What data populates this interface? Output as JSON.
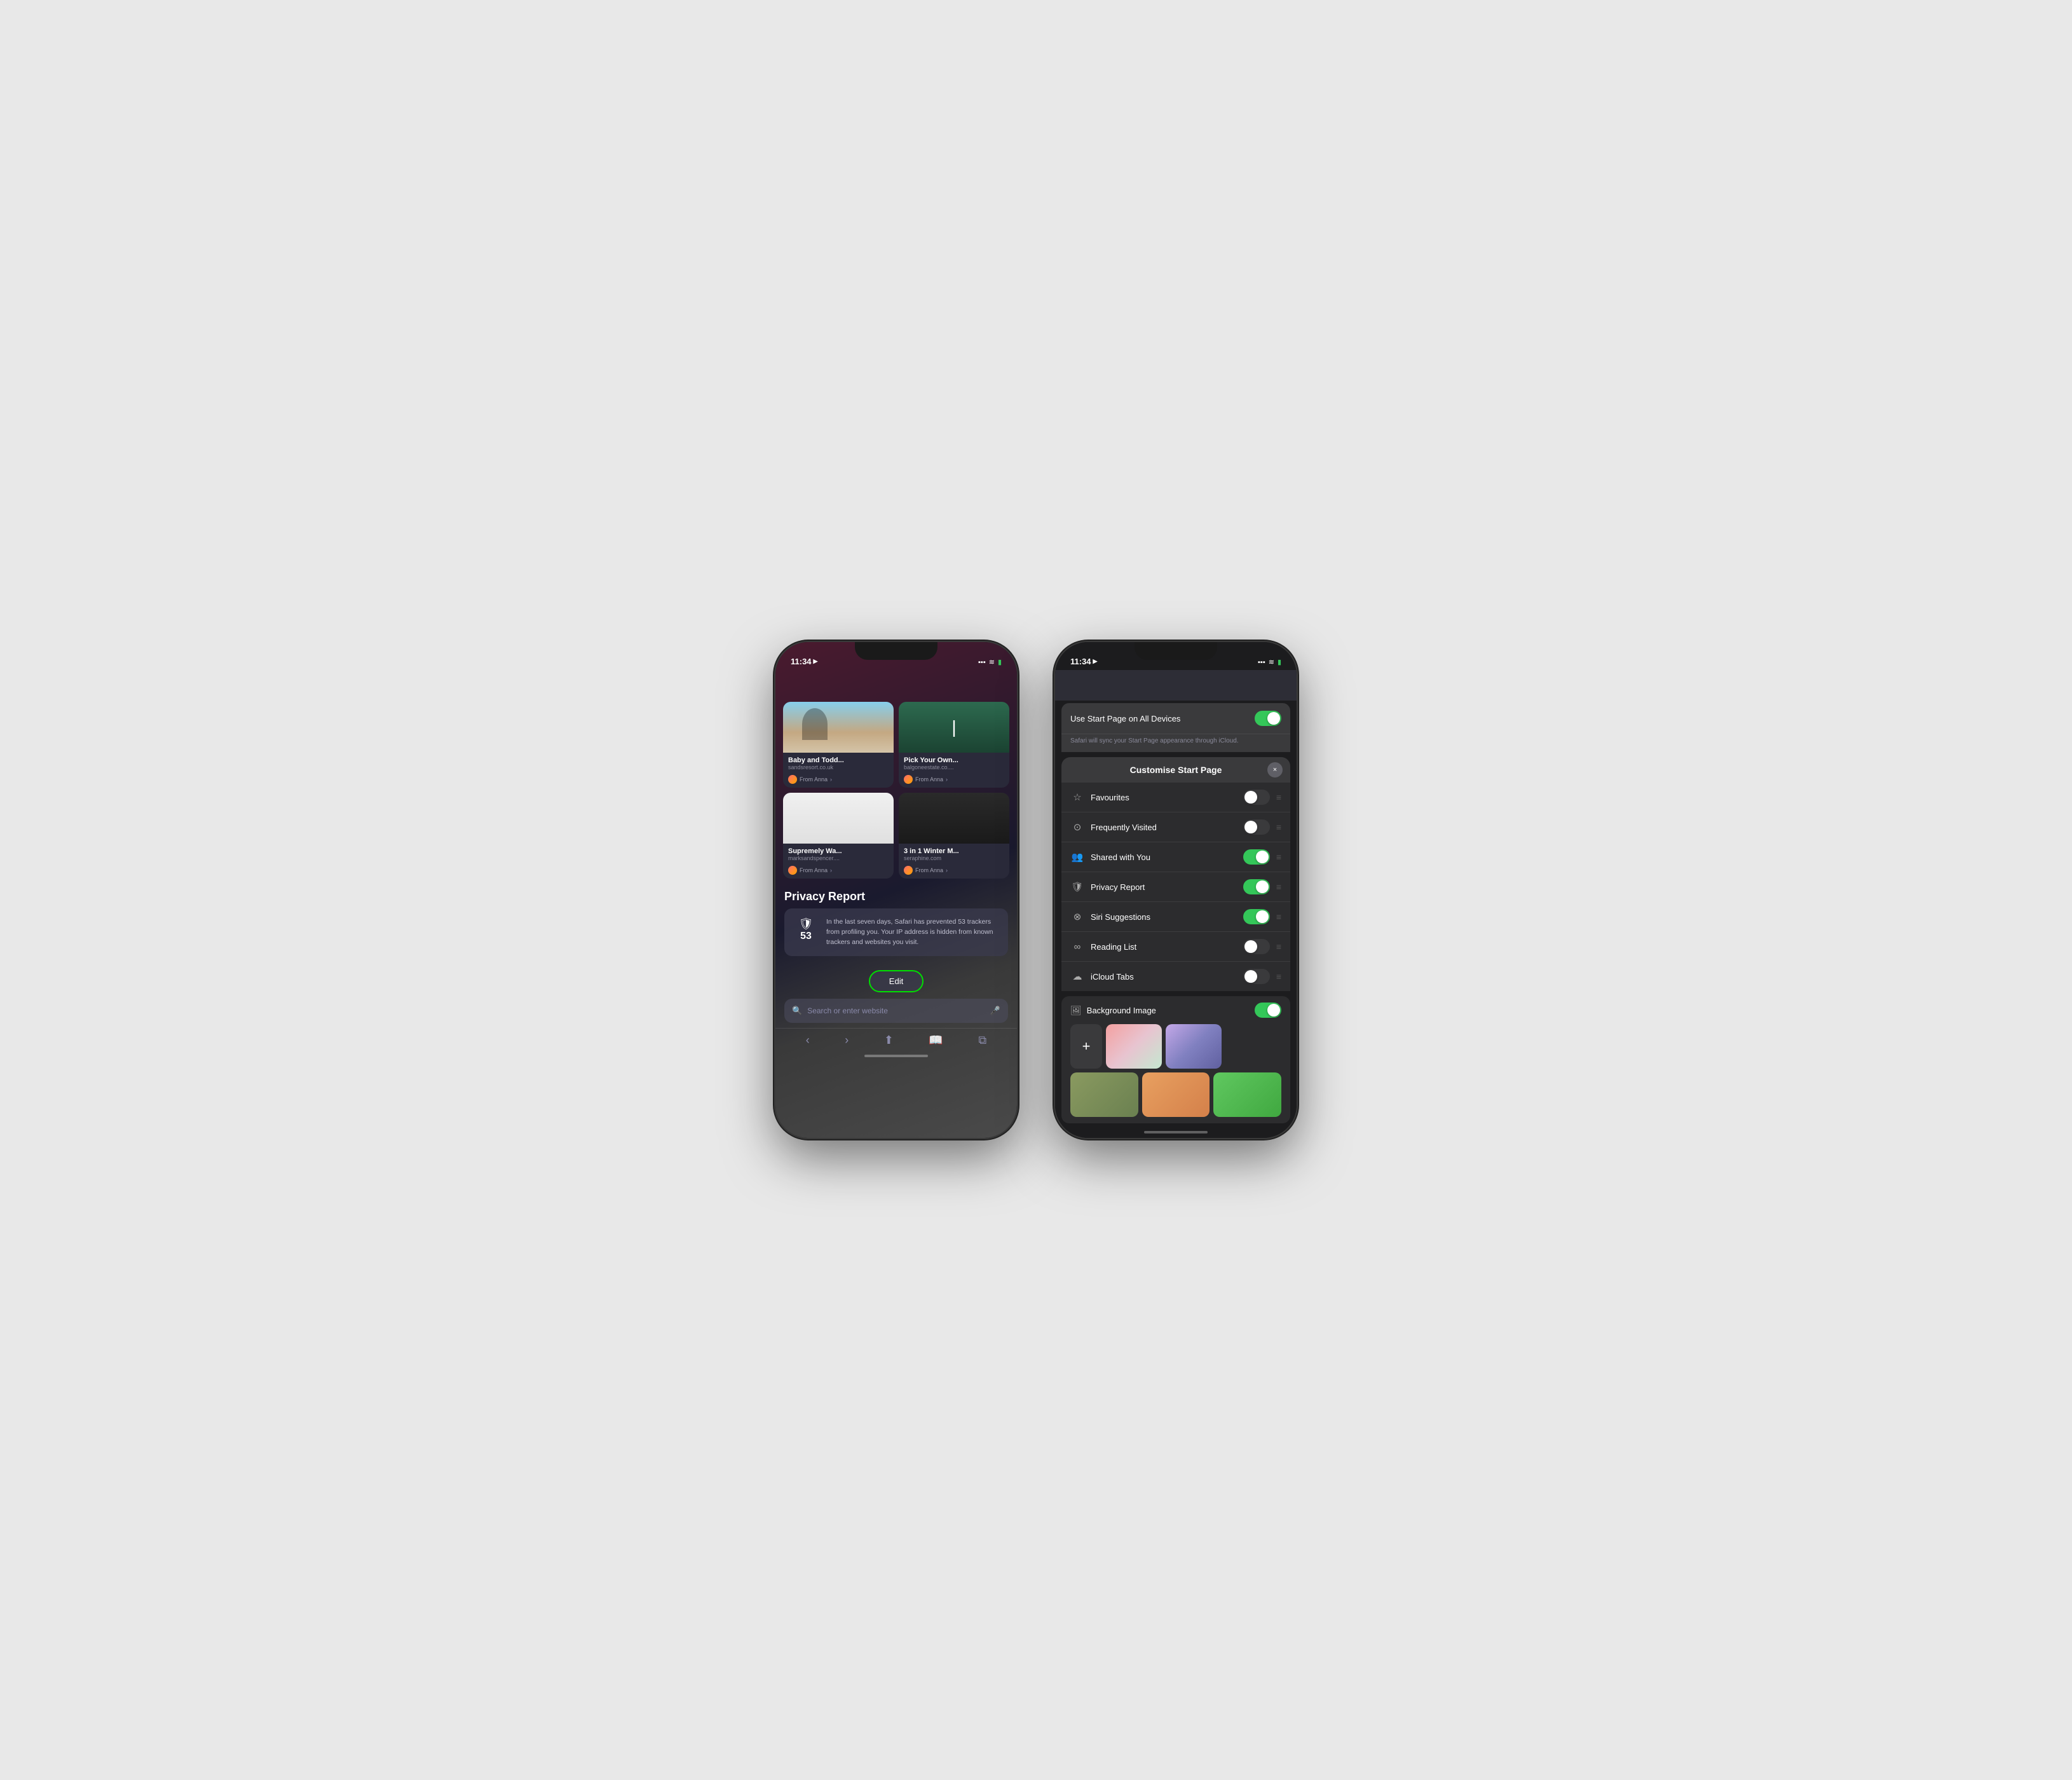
{
  "phone1": {
    "status": {
      "time": "11:34",
      "location_icon": "▶",
      "wifi": "wifi",
      "battery": "🔋"
    },
    "cards": [
      {
        "title": "Baby and Todd...",
        "domain": "sandsresort.co.uk",
        "from": "From Anna",
        "img_type": "beach"
      },
      {
        "title": "Pick Your Own...",
        "domain": "balgoneestate.co....",
        "from": "From Anna",
        "img_type": "green"
      },
      {
        "title": "Supremely Wa...",
        "domain": "marksandspencer....",
        "from": "From Anna",
        "img_type": "white"
      },
      {
        "title": "3 in 1 Winter M...",
        "domain": "seraphine.com",
        "from": "From Anna",
        "img_type": "dark"
      }
    ],
    "privacy": {
      "title": "Privacy Report",
      "count": "53",
      "text": "In the last seven days, Safari has prevented 53 trackers from profiling you. Your IP address is hidden from known trackers and websites you visit."
    },
    "edit_button": "Edit",
    "search_placeholder": "Search or enter website"
  },
  "phone2": {
    "status": {
      "time": "11:34",
      "location_icon": "▶"
    },
    "sheet": {
      "title": "Customise Start Page",
      "close": "×",
      "sync_note": "Safari will sync your Start Page appearance through iCloud.",
      "rows": [
        {
          "icon": "☆",
          "label": "Favourites",
          "toggle": "off"
        },
        {
          "icon": "⊙",
          "label": "Frequently Visited",
          "toggle": "off"
        },
        {
          "icon": "👥",
          "label": "Shared with You",
          "toggle": "on"
        },
        {
          "icon": "⊕",
          "label": "Privacy Report",
          "toggle": "on"
        },
        {
          "icon": "⊗",
          "label": "Siri Suggestions",
          "toggle": "on"
        },
        {
          "icon": "∞",
          "label": "Reading List",
          "toggle": "off"
        },
        {
          "icon": "☁",
          "label": "iCloud Tabs",
          "toggle": "off"
        }
      ],
      "use_start_page": "Use Start Page on All Devices",
      "use_start_toggle": "on",
      "background_image": "Background Image",
      "background_toggle": "on"
    }
  }
}
